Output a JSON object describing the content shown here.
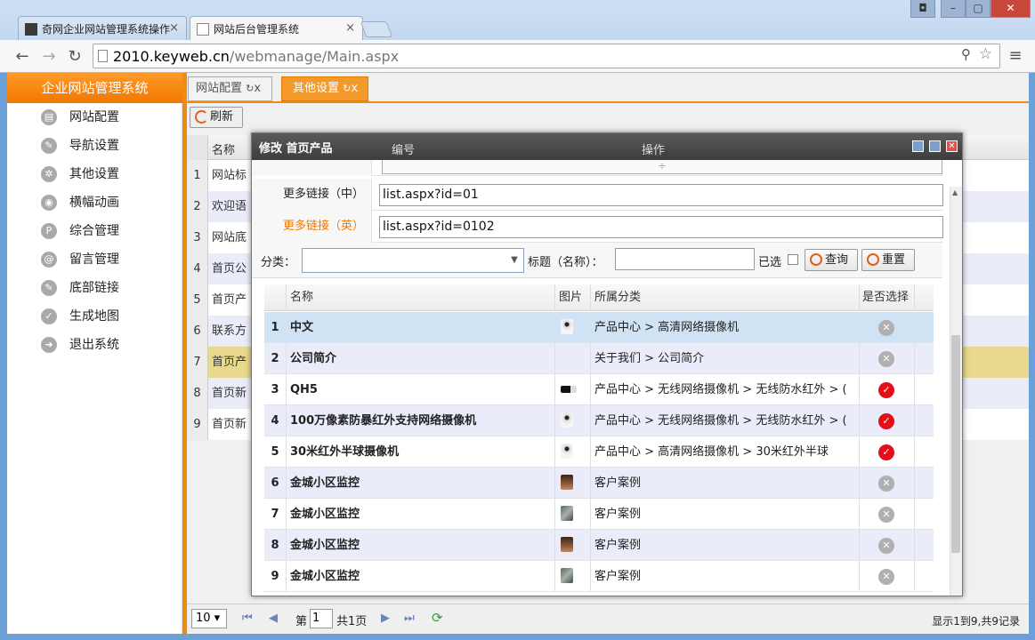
{
  "browser": {
    "tabs": [
      {
        "label": "奇网企业网站管理系统操作"
      },
      {
        "label": "网站后台管理系统"
      }
    ],
    "url_host": "2010.keyweb.cn",
    "url_path": "/webmanage/Main.aspx"
  },
  "sidebar": {
    "title": "企业网站管理系统",
    "items": [
      {
        "label": "网站配置",
        "icon": "config-icon"
      },
      {
        "label": "导航设置",
        "icon": "nav-icon"
      },
      {
        "label": "其他设置",
        "icon": "gear-icon"
      },
      {
        "label": "横幅动画",
        "icon": "banner-icon"
      },
      {
        "label": "综合管理",
        "icon": "manage-icon"
      },
      {
        "label": "留言管理",
        "icon": "at-icon"
      },
      {
        "label": "底部链接",
        "icon": "link-icon"
      },
      {
        "label": "生成地图",
        "icon": "check-icon"
      },
      {
        "label": "退出系统",
        "icon": "exit-icon"
      }
    ]
  },
  "page_tabs": [
    {
      "label": "网站配置"
    },
    {
      "label": "其他设置"
    }
  ],
  "refresh_label": "刷新",
  "bg_grid": {
    "header": "名称",
    "rows": [
      {
        "n": "1",
        "text": "网站标"
      },
      {
        "n": "2",
        "text": "欢迎语"
      },
      {
        "n": "3",
        "text": "网站底"
      },
      {
        "n": "4",
        "text": "首页公"
      },
      {
        "n": "5",
        "text": "首页产"
      },
      {
        "n": "6",
        "text": "联系方"
      },
      {
        "n": "7",
        "text": "首页产"
      },
      {
        "n": "8",
        "text": "首页新"
      },
      {
        "n": "9",
        "text": "首页新"
      }
    ]
  },
  "dialog": {
    "title": "修改 首页产品",
    "bg_head_col1": "编号",
    "bg_head_col2": "操作",
    "more_cn_label": "更多链接（中）",
    "more_cn_value": "list.aspx?id=01",
    "more_en_label": "更多链接（英）",
    "more_en_value": "list.aspx?id=0102",
    "category_label": "分类：",
    "title_label": "标题（名称）：",
    "selected_label": "已选",
    "search_btn": "查询",
    "reset_btn": "重置",
    "table_head": {
      "name": "名称",
      "img": "图片",
      "cat": "所属分类",
      "sel": "是否选择"
    },
    "rows": [
      {
        "n": "1",
        "name": "中文",
        "cat": "产品中心 > 高清网络摄像机",
        "selected": false,
        "thumb": "camera"
      },
      {
        "n": "2",
        "name": "公司简介",
        "cat": "关于我们 > 公司简介",
        "selected": false,
        "thumb": "none"
      },
      {
        "n": "3",
        "name": "QH5",
        "cat": "产品中心 > 无线网络摄像机 > 无线防水红外 > (",
        "selected": true,
        "thumb": "bullet"
      },
      {
        "n": "4",
        "name": "100万像素防暴红外支持网络摄像机",
        "cat": "产品中心 > 无线网络摄像机 > 无线防水红外 > (",
        "selected": true,
        "thumb": "camera"
      },
      {
        "n": "5",
        "name": "30米红外半球摄像机",
        "cat": "产品中心 > 高清网络摄像机 > 30米红外半球",
        "selected": true,
        "thumb": "camera"
      },
      {
        "n": "6",
        "name": "金城小区监控",
        "cat": "客户案例",
        "selected": false,
        "thumb": "person"
      },
      {
        "n": "7",
        "name": "金城小区监控",
        "cat": "客户案例",
        "selected": false,
        "thumb": "photo"
      },
      {
        "n": "8",
        "name": "金城小区监控",
        "cat": "客户案例",
        "selected": false,
        "thumb": "person"
      },
      {
        "n": "9",
        "name": "金城小区监控",
        "cat": "客户案例",
        "selected": false,
        "thumb": "photo"
      }
    ]
  },
  "pager": {
    "page_size": "10",
    "page_prefix": "第",
    "page_value": "1",
    "page_total": "共1页",
    "info": "显示1到9,共9记录"
  },
  "colors": {
    "accent": "#f08a10",
    "selected_row": "#cfe3f5",
    "check_red": "#e3101a"
  }
}
